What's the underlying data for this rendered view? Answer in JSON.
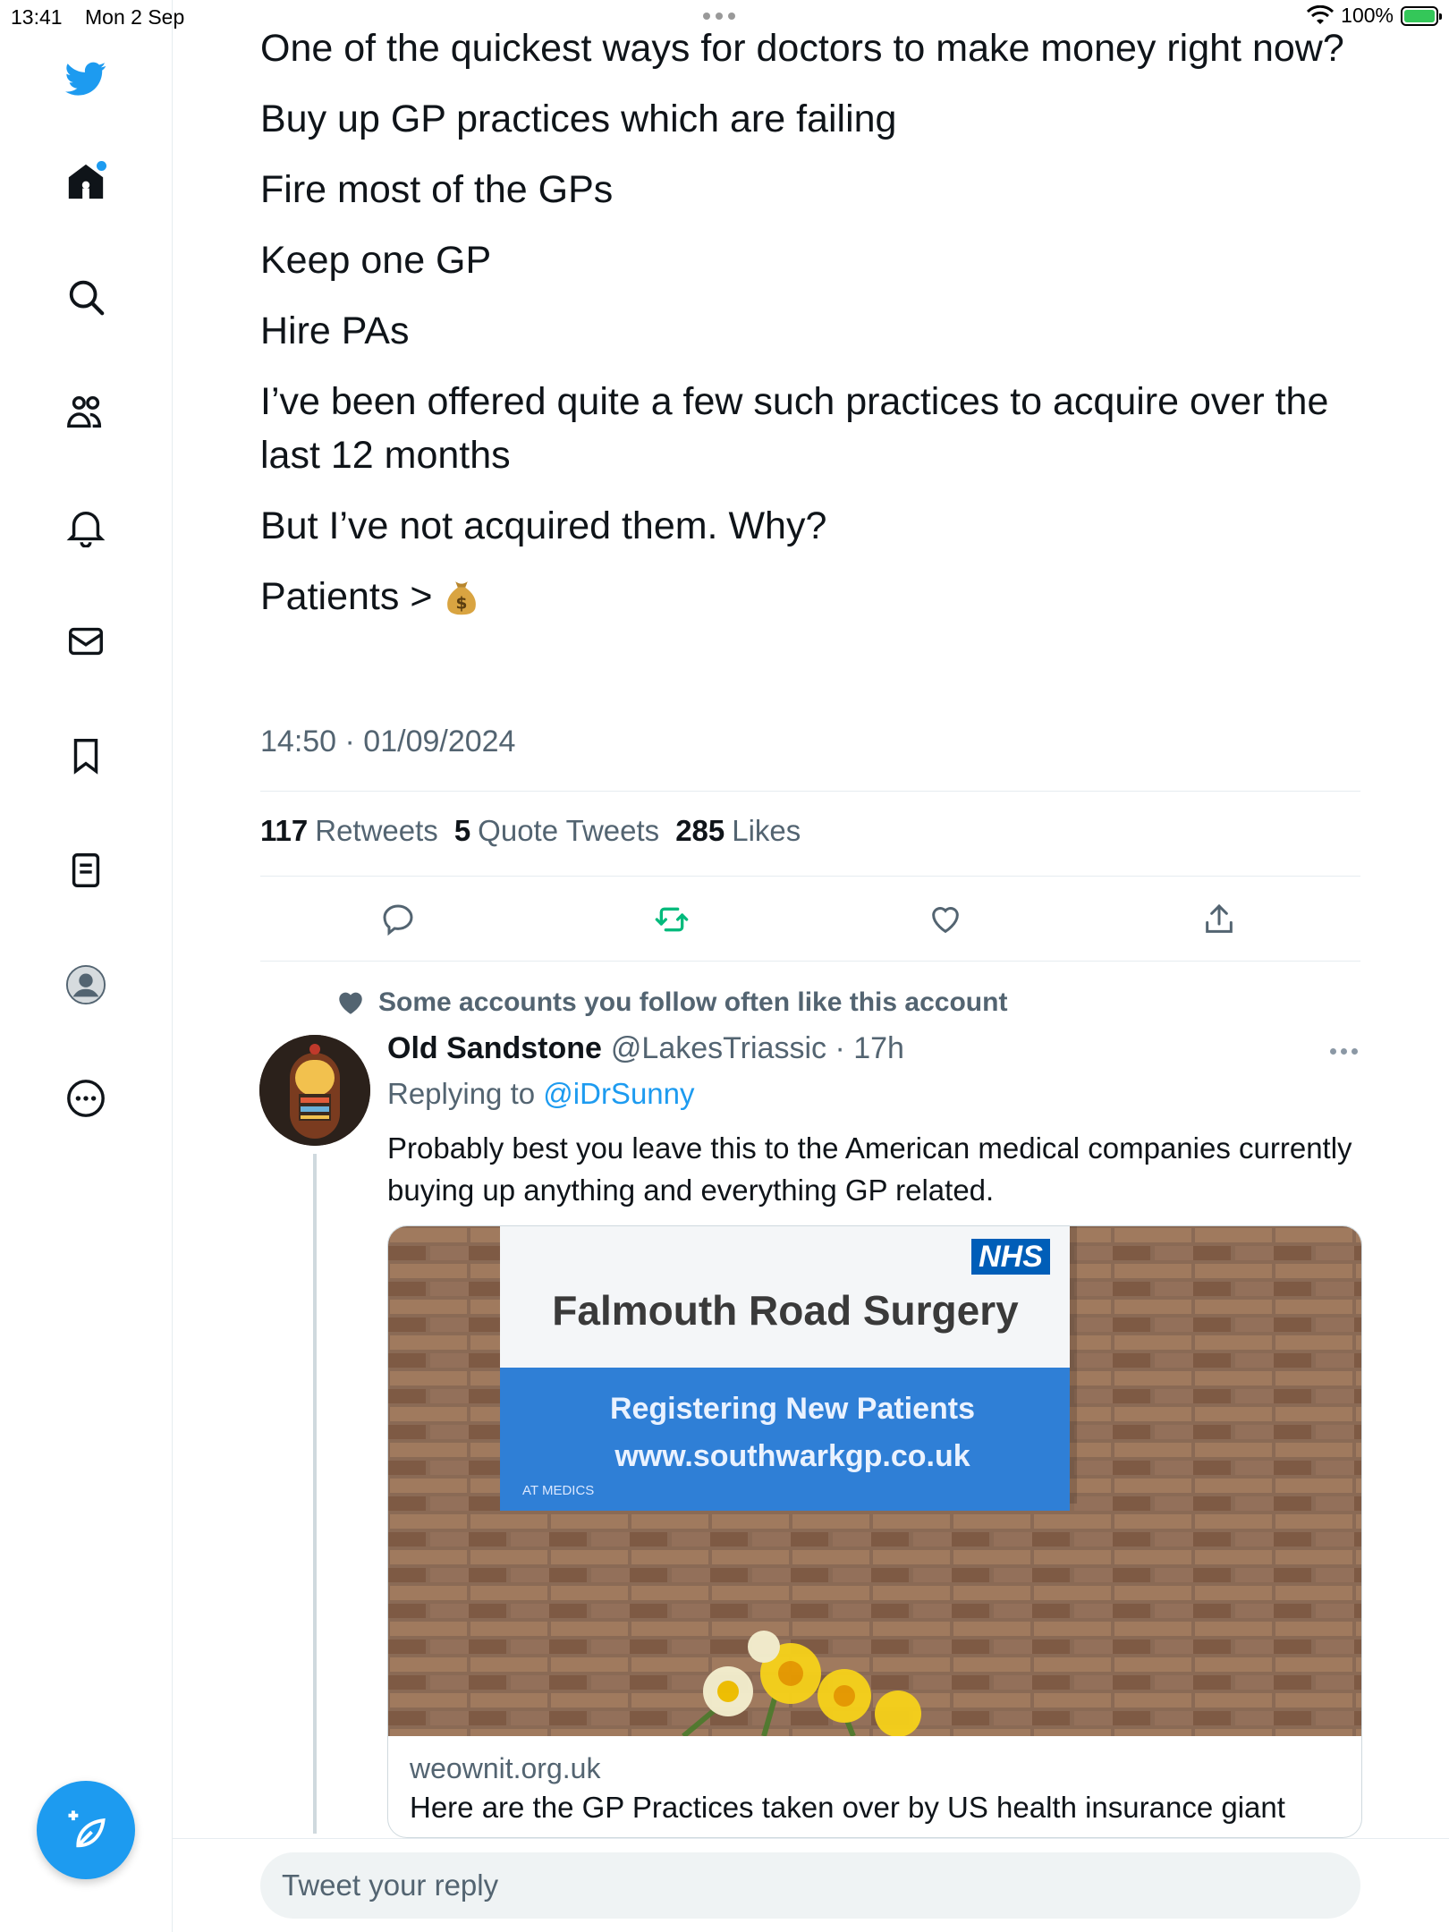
{
  "status_bar": {
    "time": "13:41",
    "date": "Mon 2 Sep",
    "battery_percent": "100%",
    "battery_color": "#34c759"
  },
  "sidebar": {
    "items": [
      {
        "icon": "twitter-bird-icon"
      },
      {
        "icon": "home-icon",
        "has_badge": true
      },
      {
        "icon": "search-icon"
      },
      {
        "icon": "communities-icon"
      },
      {
        "icon": "notifications-bell-icon"
      },
      {
        "icon": "messages-envelope-icon"
      },
      {
        "icon": "bookmark-icon"
      },
      {
        "icon": "lists-icon"
      },
      {
        "icon": "profile-avatar-icon"
      },
      {
        "icon": "more-circle-icon"
      }
    ],
    "compose_icon": "compose-tweet-icon"
  },
  "tweet": {
    "lines": [
      "One of the quickest ways for doctors to make money right now?",
      "Buy up GP practices which are failing",
      "Fire most of the GPs",
      "Keep one GP",
      "Hire PAs",
      "I’ve been offered quite a few such practices to acquire over the last 12 months",
      "But I’ve not acquired them. Why?",
      "Patients >"
    ],
    "emoji": "money-bag-icon",
    "timestamp": "14:50 · 01/09/2024",
    "stats": {
      "retweets_count": "117",
      "retweets_label": "Retweets",
      "quotes_count": "5",
      "quotes_label": "Quote Tweets",
      "likes_count": "285",
      "likes_label": "Likes"
    },
    "retweet_active_color": "#00ba7c"
  },
  "reply": {
    "social_context": "Some accounts you follow often like this account",
    "name": "Old Sandstone",
    "handle": "@LakesTriassic",
    "time": "· 17h",
    "replying_prefix": "Replying to",
    "replying_handle": "@iDrSunny",
    "text": "Probably best you leave this to the American medical companies currently buying up anything and everything GP related.",
    "card": {
      "domain": "weownit.org.uk",
      "title": "Here are the GP Practices taken over by US health insurance giant",
      "image": {
        "nhs": "NHS",
        "surgery_name": "Falmouth Road Surgery",
        "banner_line1": "Registering New Patients",
        "banner_line2": "www.southwarkgp.co.uk",
        "small_logo": "AT MEDICS"
      }
    }
  },
  "compose": {
    "placeholder": "Tweet your reply"
  }
}
